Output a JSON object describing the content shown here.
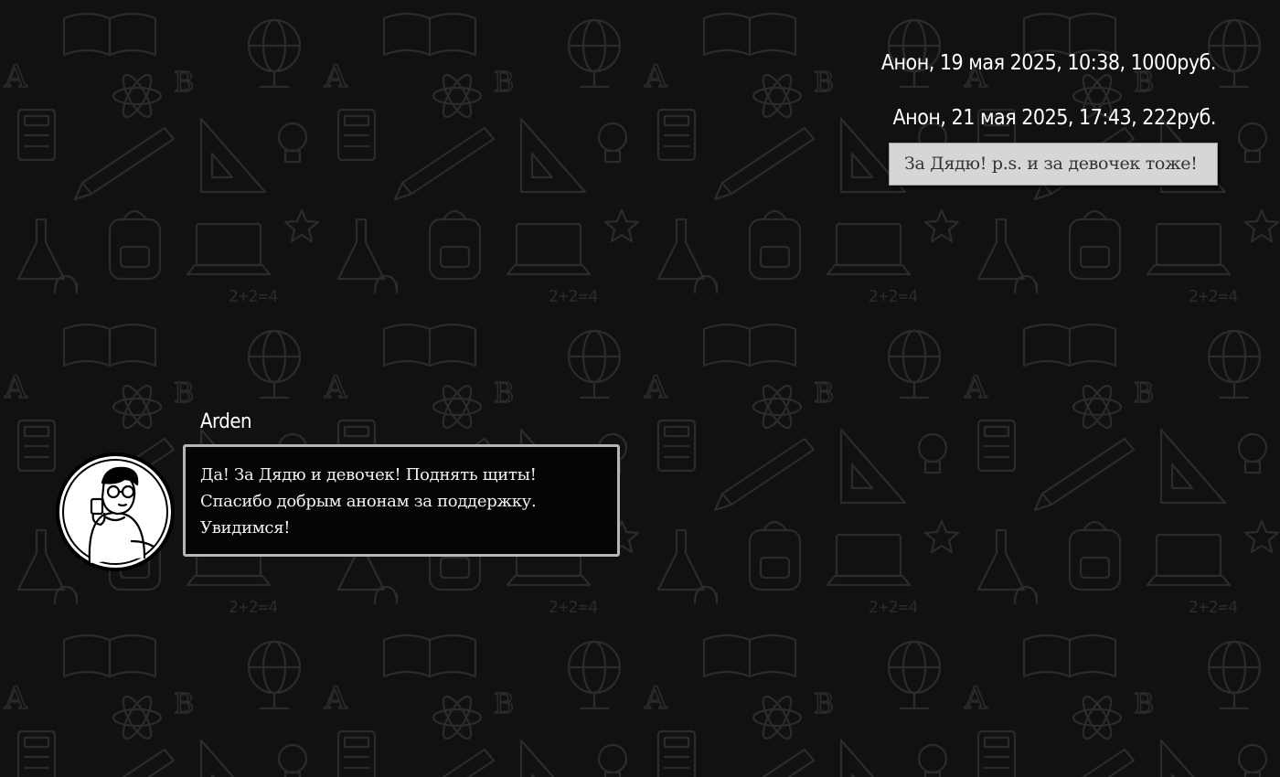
{
  "donations": [
    {
      "header": "Анон, 19 мая 2025, 10:38, 1000руб.",
      "message": ""
    },
    {
      "header": "Анон, 21 мая 2025, 17:43, 222руб.",
      "message": "За Дядю! p.s. и за девочек тоже!"
    }
  ],
  "reply": {
    "author": "Arden",
    "avatar_icon": "avatar-icon",
    "lines": [
      "Да! За Дядю и девочек! Поднять щиты!",
      "Спасибо добрым анонам за поддержку.",
      "Увидимся!"
    ]
  },
  "colors": {
    "background": "#111111",
    "doodle_stroke": "#2a2a2a",
    "text": "#ffffff",
    "message_box": "#d6d6d6",
    "reply_box": "#050505",
    "reply_border": "#b5b5b5"
  }
}
